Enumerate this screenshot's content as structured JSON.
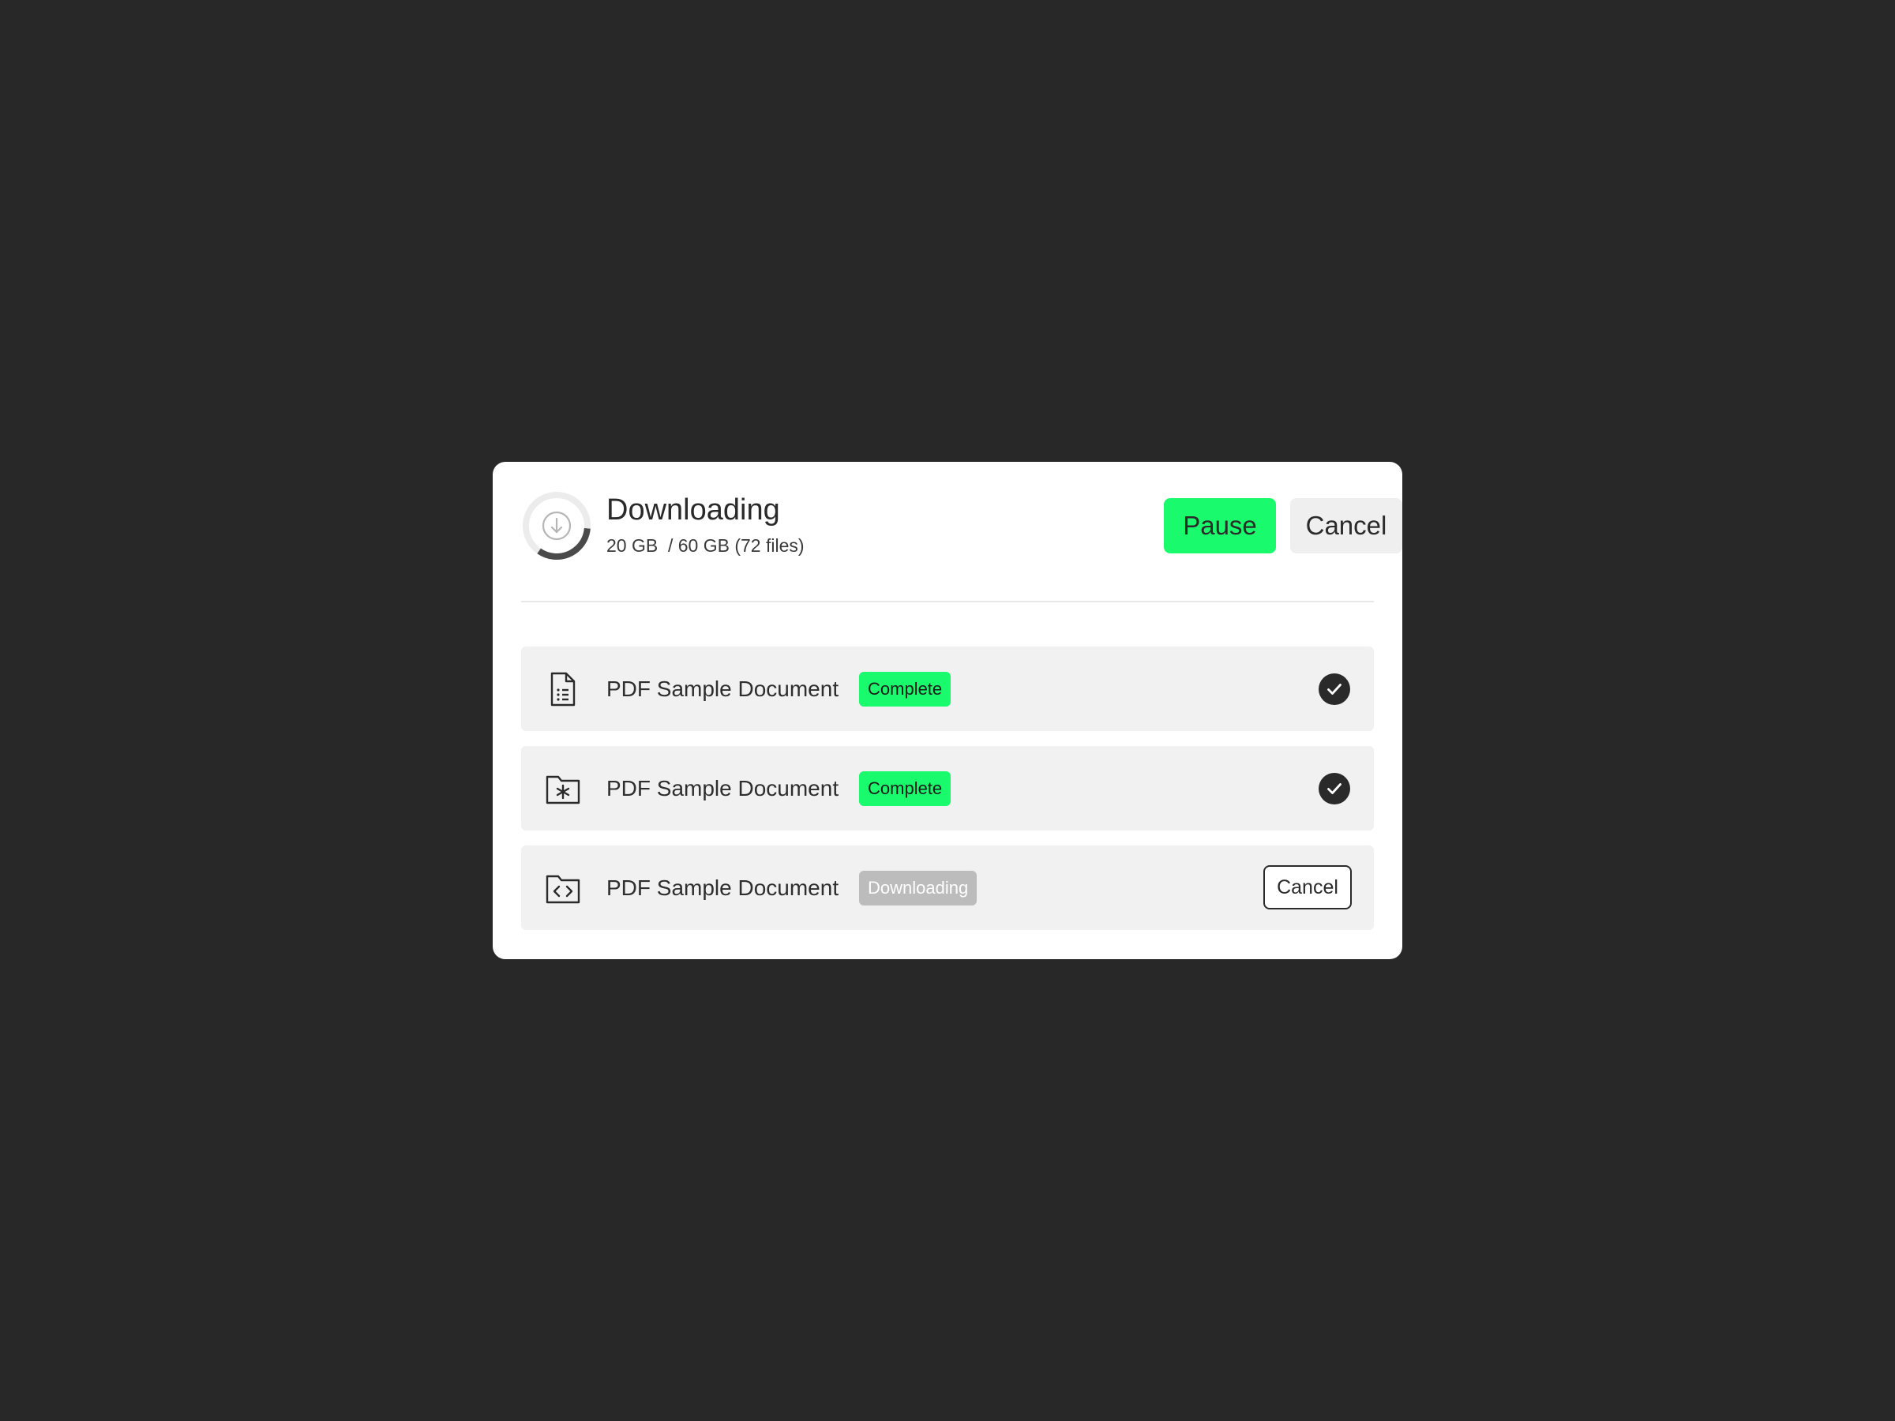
{
  "dialog": {
    "title": "Downloading",
    "subtitle": "20 GB  / 60 GB (72 files)",
    "progress_fraction": 0.333,
    "download_icon": "download-arrow-icon",
    "pause_label": "Pause",
    "cancel_label": "Cancel"
  },
  "files": [
    {
      "name": "PDF Sample Document",
      "status": "Complete",
      "icon": "document-list-icon",
      "action": "check-circle-icon"
    },
    {
      "name": "PDF Sample Document",
      "status": "Complete",
      "icon": "folder-asterisk-icon",
      "action": "check-circle-icon"
    },
    {
      "name": "PDF Sample Document",
      "status": "Downloading",
      "icon": "folder-code-icon",
      "action_label": "Cancel"
    }
  ],
  "colors": {
    "background": "#282828",
    "accent": "#19fa6c",
    "secondary_button": "#efefef",
    "row_background": "#f1f1f1",
    "badge_downloading": "#bcbcbc",
    "text": "#2a2a2a"
  }
}
